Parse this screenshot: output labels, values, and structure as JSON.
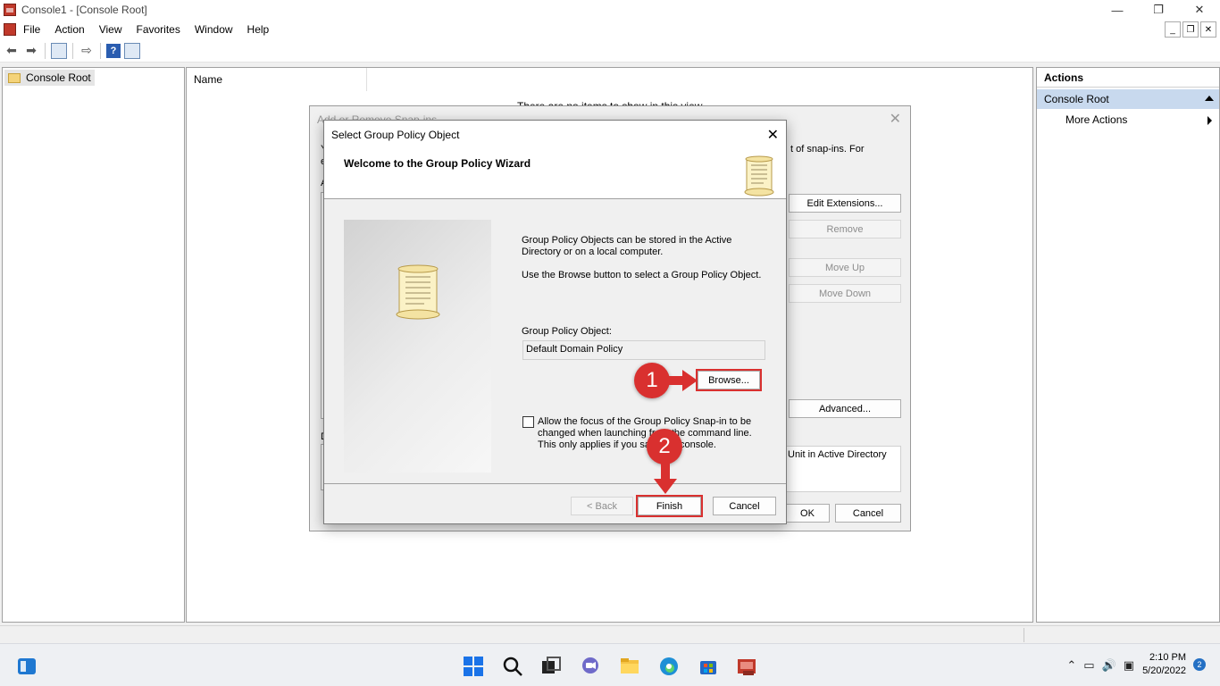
{
  "window": {
    "title": "Console1 - [Console Root]",
    "controls": {
      "minimize": "—",
      "maximize": "❐",
      "close": "✕"
    }
  },
  "menu": {
    "items": [
      "File",
      "Action",
      "View",
      "Favorites",
      "Window",
      "Help"
    ],
    "mdi_controls": {
      "minimize": "_",
      "restore": "❐",
      "close": "✕"
    }
  },
  "tree": {
    "root_label": "Console Root"
  },
  "center": {
    "column_header": "Name",
    "empty_message": "There are no items to show in this view."
  },
  "actions_pane": {
    "title": "Actions",
    "section": "Console Root",
    "items": [
      "More Actions"
    ]
  },
  "snapin_dialog": {
    "title": "Add or Remove Snap-ins",
    "close": "✕",
    "fragments": {
      "f1": "Y",
      "f2": "e",
      "f3": "A",
      "f4": "D"
    },
    "desc_fragment": "t of snap-ins. For",
    "buttons": {
      "edit_extensions": "Edit Extensions...",
      "remove": "Remove",
      "move_up": "Move Up",
      "move_down": "Move Down",
      "advanced": "Advanced...",
      "ok": "OK",
      "cancel": "Cancel"
    },
    "info_text": "Unit in Active Directory"
  },
  "wizard": {
    "title": "Select Group Policy Object",
    "close": "✕",
    "heading": "Welcome to the Group Policy Wizard",
    "text1": "Group Policy Objects can be stored in the Active Directory or on a local computer.",
    "text2": "Use the Browse button to select a Group Policy Object.",
    "gpo_label": "Group Policy Object:",
    "gpo_value": "Default Domain Policy",
    "browse": "Browse...",
    "checkbox_label": "Allow the focus of the Group Policy Snap-in to be changed when launching from the command line.  This only applies if you save the console.",
    "checkbox_checked": false,
    "back": "< Back",
    "finish": "Finish",
    "cancel": "Cancel"
  },
  "annotations": {
    "step1": "1",
    "step2": "2",
    "color": "#d9302f"
  },
  "taskbar": {
    "icons": [
      "start-icon",
      "search-icon",
      "task-view-icon",
      "chat-icon",
      "file-explorer-icon",
      "edge-icon",
      "store-icon",
      "mmc-icon"
    ],
    "time": "2:10 PM",
    "date": "5/20/2022",
    "notification_count": "2"
  }
}
